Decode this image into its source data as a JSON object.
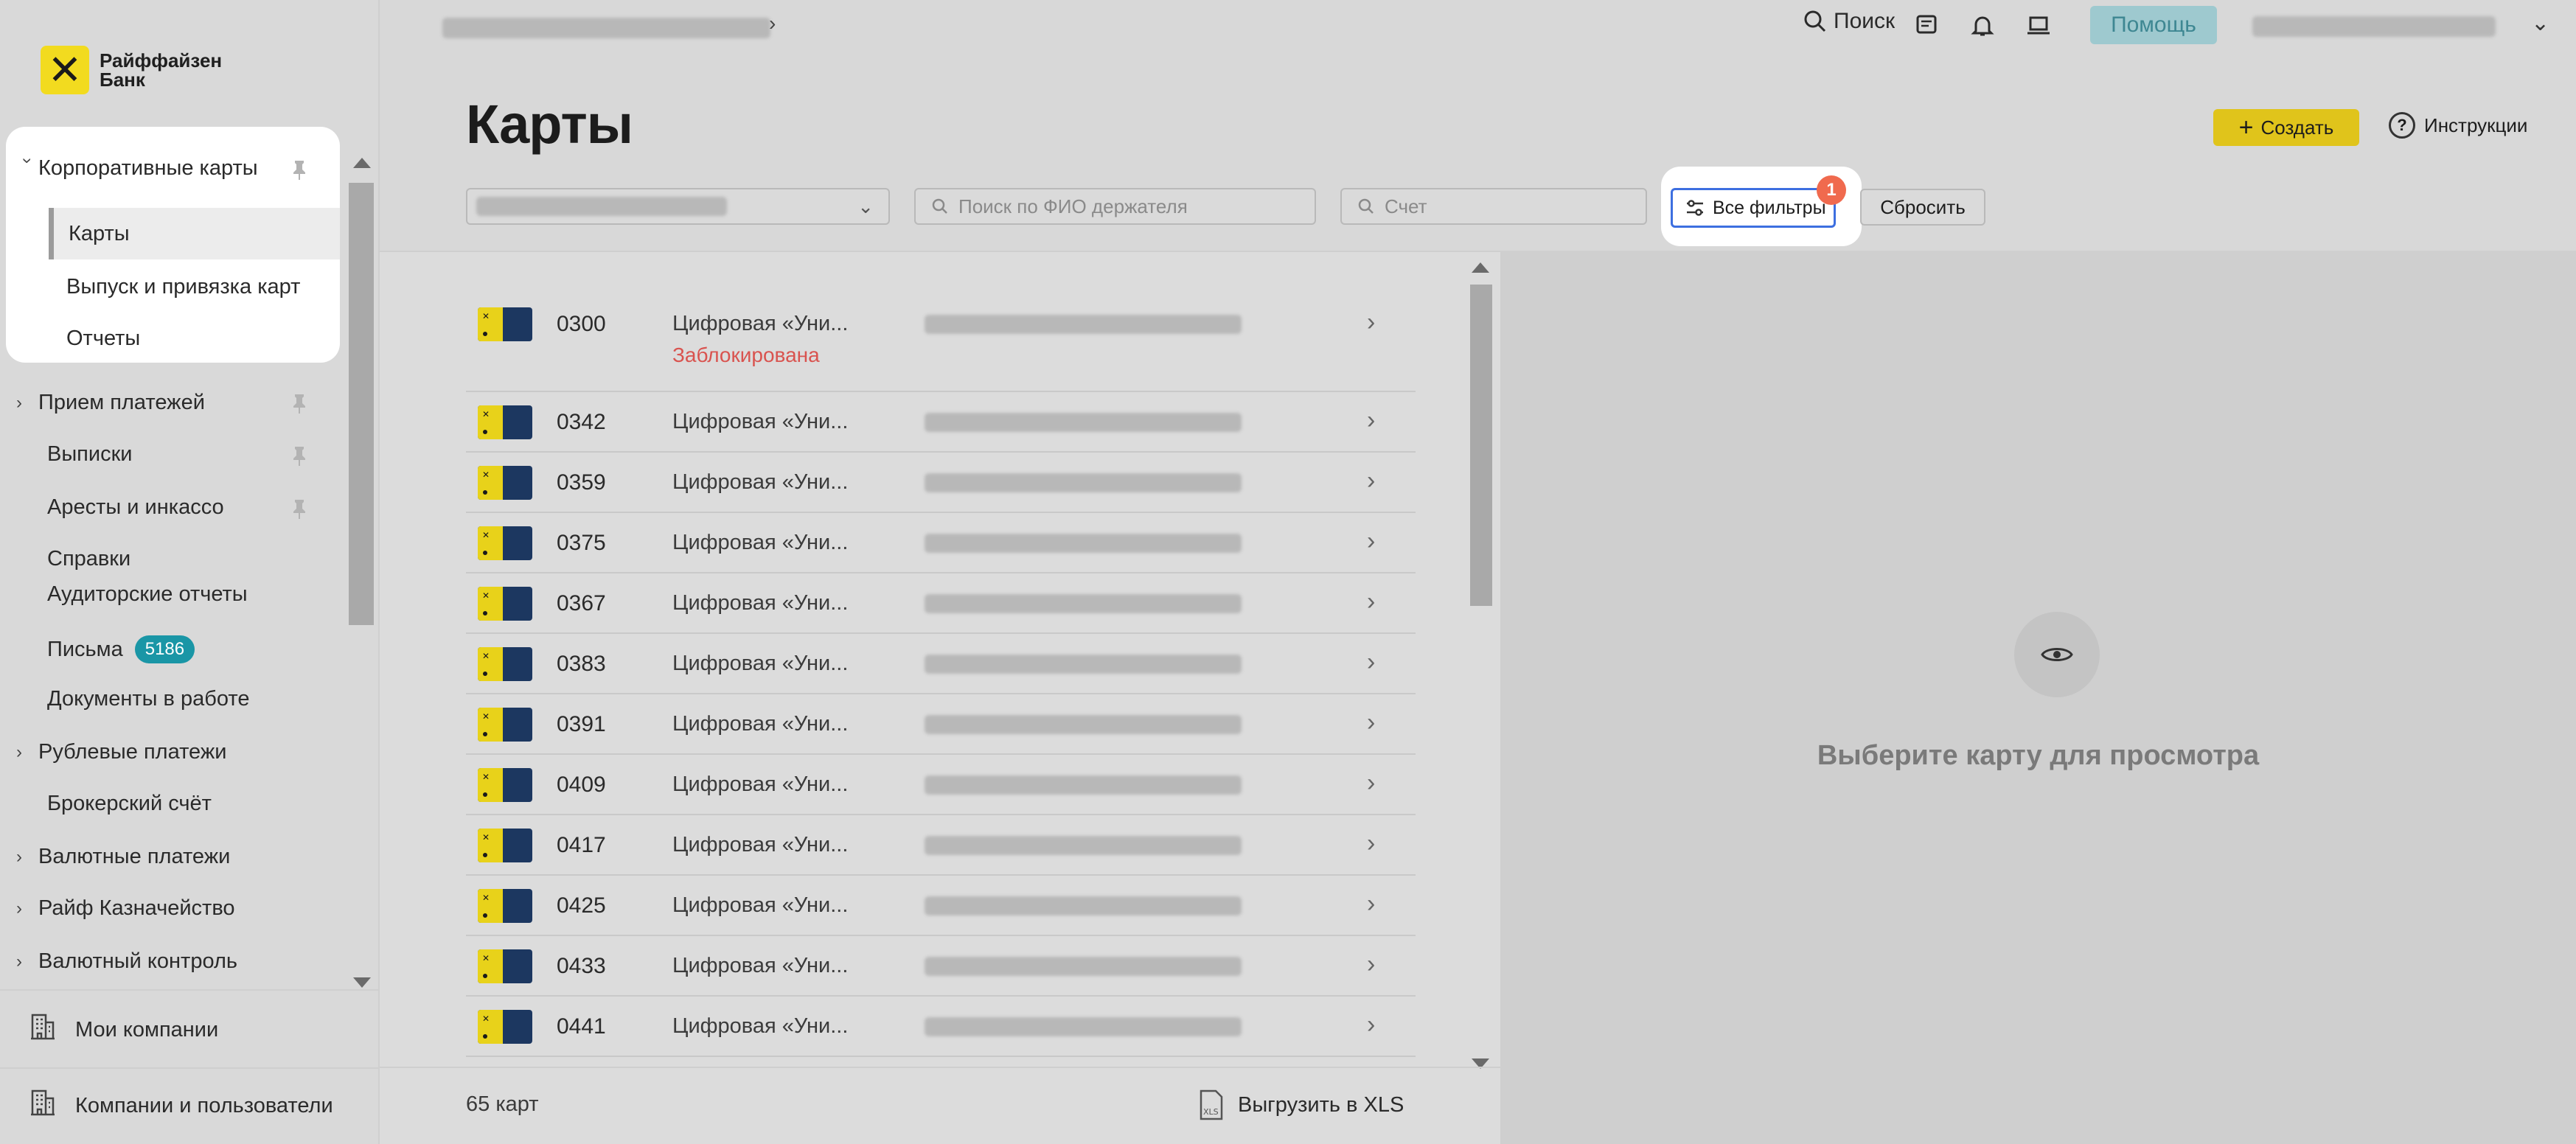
{
  "app": {
    "logo_text": "Райффайзен Банк"
  },
  "topbar": {
    "search_label": "Поиск",
    "help_label": "Помощь"
  },
  "sidebar": {
    "corporate_cards": "Корпоративные карты",
    "sub_items": [
      "Карты",
      "Выпуск и привязка карт",
      "Отчеты"
    ],
    "items": [
      {
        "label": "Прием платежей"
      },
      {
        "label": "Выписки"
      },
      {
        "label": "Аресты и инкассо"
      },
      {
        "label": "Справки"
      },
      {
        "label": "Аудиторские отчеты"
      },
      {
        "label": "Письма",
        "badge": "5186"
      },
      {
        "label": "Документы в работе"
      },
      {
        "label": "Рублевые платежи"
      },
      {
        "label": "Брокерский счёт"
      },
      {
        "label": "Валютные платежи"
      },
      {
        "label": "Райф Казначейство"
      },
      {
        "label": "Валютный контроль"
      }
    ],
    "footer": {
      "my_companies": "Мои компании",
      "companies_users": "Компании и пользователи"
    }
  },
  "header": {
    "title": "Карты",
    "create_label": "Создать",
    "instructions_label": "Инструкции"
  },
  "filters": {
    "holder_placeholder": "Поиск по ФИО держателя",
    "account_placeholder": "Счет",
    "all_filters_label": "Все фильтры",
    "all_filters_count": "1",
    "reset_label": "Сбросить"
  },
  "cards": [
    {
      "number": "0300",
      "product": "Цифровая «Уни...",
      "status": "Заблокирована"
    },
    {
      "number": "0342",
      "product": "Цифровая «Уни..."
    },
    {
      "number": "0359",
      "product": "Цифровая «Уни..."
    },
    {
      "number": "0375",
      "product": "Цифровая «Уни..."
    },
    {
      "number": "0367",
      "product": "Цифровая «Уни..."
    },
    {
      "number": "0383",
      "product": "Цифровая «Уни..."
    },
    {
      "number": "0391",
      "product": "Цифровая «Уни..."
    },
    {
      "number": "0409",
      "product": "Цифровая «Уни..."
    },
    {
      "number": "0417",
      "product": "Цифровая «Уни..."
    },
    {
      "number": "0425",
      "product": "Цифровая «Уни..."
    },
    {
      "number": "0433",
      "product": "Цифровая «Уни..."
    },
    {
      "number": "0441",
      "product": "Цифровая «Уни..."
    }
  ],
  "list_footer": {
    "count": "65 карт",
    "export_label": "Выгрузить в XLS"
  },
  "detail": {
    "empty_text": "Выберите карту для просмотра"
  },
  "colors": {
    "brand_yellow": "#e0c41b",
    "badge_teal": "#1a96a6",
    "status_red": "#d9534f",
    "focus_blue": "#3d6fe0",
    "counter_orange": "#f06a4e"
  }
}
